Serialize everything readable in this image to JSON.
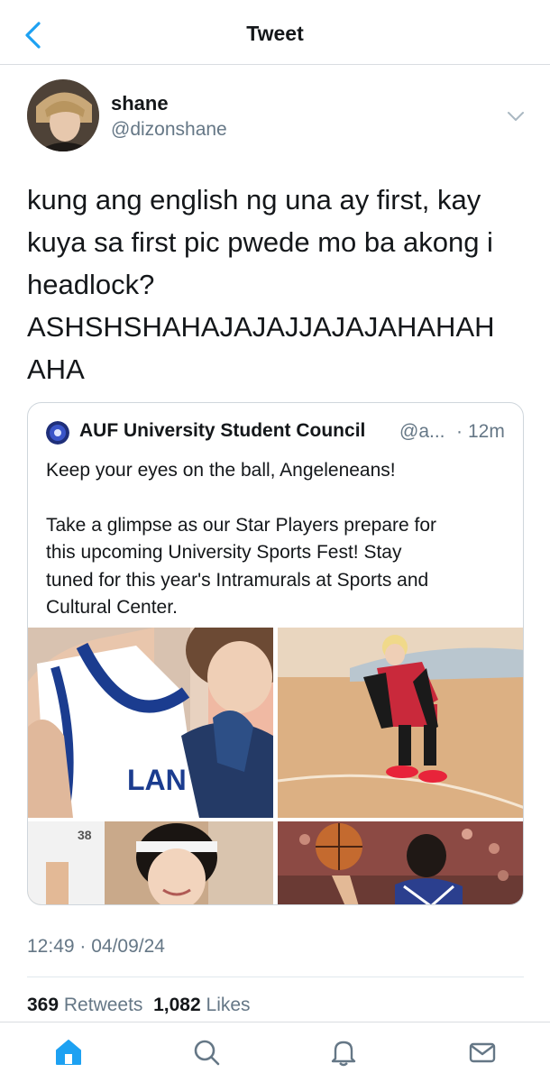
{
  "header": {
    "title": "Tweet",
    "back_icon": "chevron-left-icon",
    "accent": "#1da1f2"
  },
  "tweet": {
    "display_name": "shane",
    "handle": "@dizonshane",
    "text_lines": [
      "kung ang english ng una ay first, kay",
      "kuya sa first pic pwede mo ba akong i",
      "headlock?",
      "ASHSHSHAHAJAJAJJAJAJAHAHAH",
      "AHA"
    ],
    "timestamp": "12:49 · 04/09/24",
    "retweet_count": "369",
    "retweet_label": "Retweets",
    "like_count": "1,082",
    "like_label": "Likes"
  },
  "quote": {
    "name": "AUF University Student Council",
    "handle": "@a...",
    "separator": "·",
    "time": "12m",
    "paragraph1": "Keep your eyes on the ball, Angeleneans!",
    "paragraph2_lines": [
      "Take a glimpse as our Star Players prepare for",
      "this upcoming University Sports Fest! Stay",
      "tuned for this year's Intramurals at Sports and",
      "Cultural Center."
    ],
    "photos": [
      "photo-player-jersey",
      "photo-basketball-court",
      "photo-player-headband",
      "photo-basketball-game"
    ]
  },
  "tabbar": {
    "items": [
      "home-icon",
      "search-icon",
      "bell-icon",
      "mail-icon"
    ],
    "active_color": "#1da1f2",
    "inactive_color": "#657786"
  }
}
